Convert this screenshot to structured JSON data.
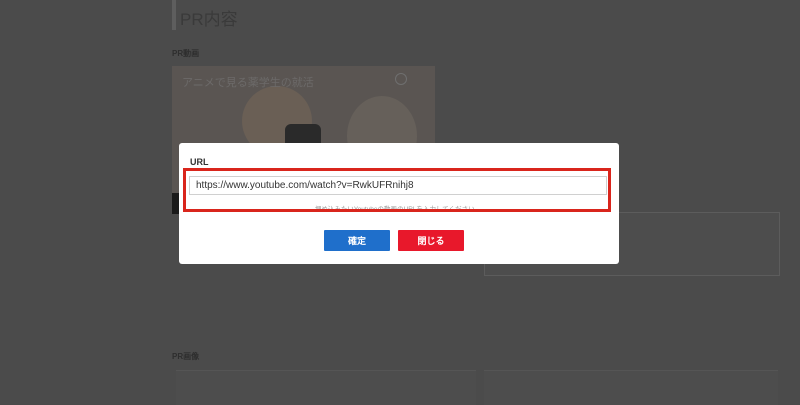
{
  "page": {
    "section_title": "PR内容",
    "video_label": "PR動画",
    "video_title": "アニメで見る薬学生の就活",
    "image_label": "PR画像"
  },
  "modal": {
    "label": "URL",
    "url_value": "https://www.youtube.com/watch?v=RwkUFRnihj8",
    "hint": "埋め込みたいYoutubeの動画のURLを入力してください。",
    "confirm_label": "確定",
    "close_label": "閉じる"
  },
  "colors": {
    "confirm": "#1f6fcb",
    "close": "#e8182b",
    "highlight": "#d9251c",
    "overlay": "#4b4b4b"
  }
}
